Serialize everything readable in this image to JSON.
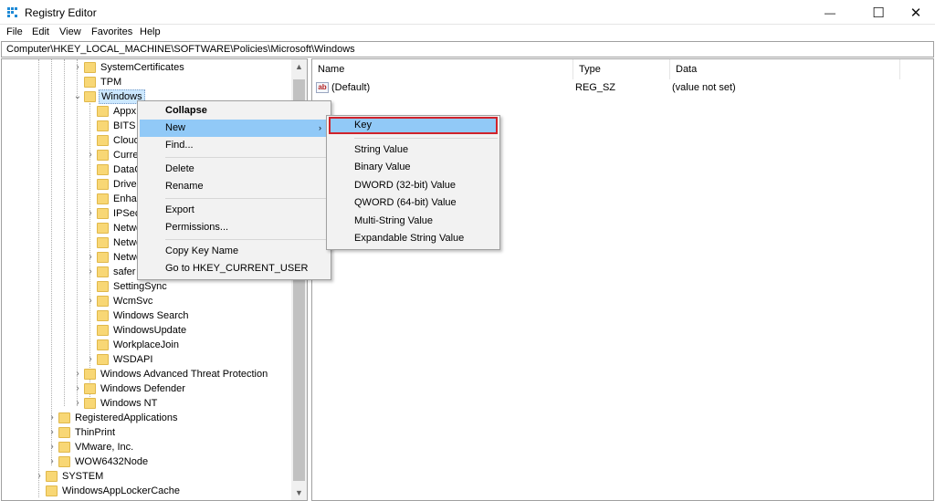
{
  "window": {
    "title": "Registry Editor",
    "minimize_glyph": "—",
    "maximize_glyph": "☐",
    "close_glyph": "✕"
  },
  "menubar": [
    "File",
    "Edit",
    "View",
    "Favorites",
    "Help"
  ],
  "address": "Computer\\HKEY_LOCAL_MACHINE\\SOFTWARE\\Policies\\Microsoft\\Windows",
  "tree": [
    {
      "label": "SystemCertificates"
    },
    {
      "label": "TPM"
    },
    {
      "label": "Windows"
    },
    {
      "label": "Appx"
    },
    {
      "label": "BITS"
    },
    {
      "label": "Cloud"
    },
    {
      "label": "Curren"
    },
    {
      "label": "DataC"
    },
    {
      "label": "Driver"
    },
    {
      "label": "Enhan"
    },
    {
      "label": "IPSec"
    },
    {
      "label": "Netwo"
    },
    {
      "label": "Netwo"
    },
    {
      "label": "Netwo"
    },
    {
      "label": "safer"
    },
    {
      "label": "SettingSync"
    },
    {
      "label": "WcmSvc"
    },
    {
      "label": "Windows Search"
    },
    {
      "label": "WindowsUpdate"
    },
    {
      "label": "WorkplaceJoin"
    },
    {
      "label": "WSDAPI"
    },
    {
      "label": "Windows Advanced Threat Protection"
    },
    {
      "label": "Windows Defender"
    },
    {
      "label": "Windows NT"
    },
    {
      "label": "RegisteredApplications"
    },
    {
      "label": "ThinPrint"
    },
    {
      "label": "VMware, Inc."
    },
    {
      "label": "WOW6432Node"
    },
    {
      "label": "SYSTEM"
    },
    {
      "label": "WindowsAppLockerCache"
    }
  ],
  "list": {
    "columns": [
      "Name",
      "Type",
      "Data"
    ],
    "rows": [
      {
        "name": "(Default)",
        "type": "REG_SZ",
        "data": "(value not set)",
        "icon": "ab"
      }
    ]
  },
  "context_menu": {
    "items": [
      "Collapse",
      "New",
      "Find...",
      "Delete",
      "Rename",
      "Export",
      "Permissions...",
      "Copy Key Name",
      "Go to HKEY_CURRENT_USER"
    ],
    "active_item": "New",
    "submenu_arrow": "›"
  },
  "new_submenu": {
    "items": [
      "Key",
      "String Value",
      "Binary Value",
      "DWORD (32-bit) Value",
      "QWORD (64-bit) Value",
      "Multi-String Value",
      "Expandable String Value"
    ],
    "highlighted": "Key",
    "highlight_color": "#91c9f7",
    "annotation_color": "#d0222a"
  },
  "scroll": {
    "up": "▲",
    "down": "▼"
  }
}
